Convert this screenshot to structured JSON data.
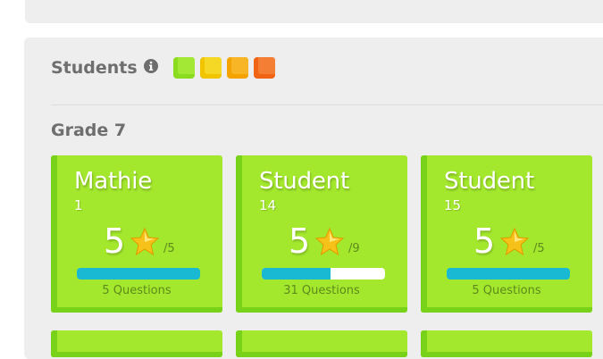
{
  "students_panel": {
    "title": "Students",
    "legend": [
      {
        "color": "#8bdc1e",
        "inner": "#a6ea3a"
      },
      {
        "color": "#f1c400",
        "inner": "#f6dc2c"
      },
      {
        "color": "#f5a300",
        "inner": "#f8b82c"
      },
      {
        "color": "#f06414",
        "inner": "#f5823a"
      }
    ]
  },
  "grade": {
    "title": "Grade 7"
  },
  "cards": [
    {
      "name": "Mathie",
      "id": "1",
      "score": "5",
      "total": "/5",
      "progress": 1.0,
      "questions": "5 Questions"
    },
    {
      "name": "Student",
      "id": "14",
      "score": "5",
      "total": "/9",
      "progress": 0.56,
      "questions": "31 Questions"
    },
    {
      "name": "Student",
      "id": "15",
      "score": "5",
      "total": "/5",
      "progress": 1.0,
      "questions": "5 Questions"
    }
  ],
  "colors": {
    "card": "#a3e82d",
    "card_edge": "#79d21a",
    "bar": "#19b9d4",
    "panel": "#eeeeee"
  }
}
